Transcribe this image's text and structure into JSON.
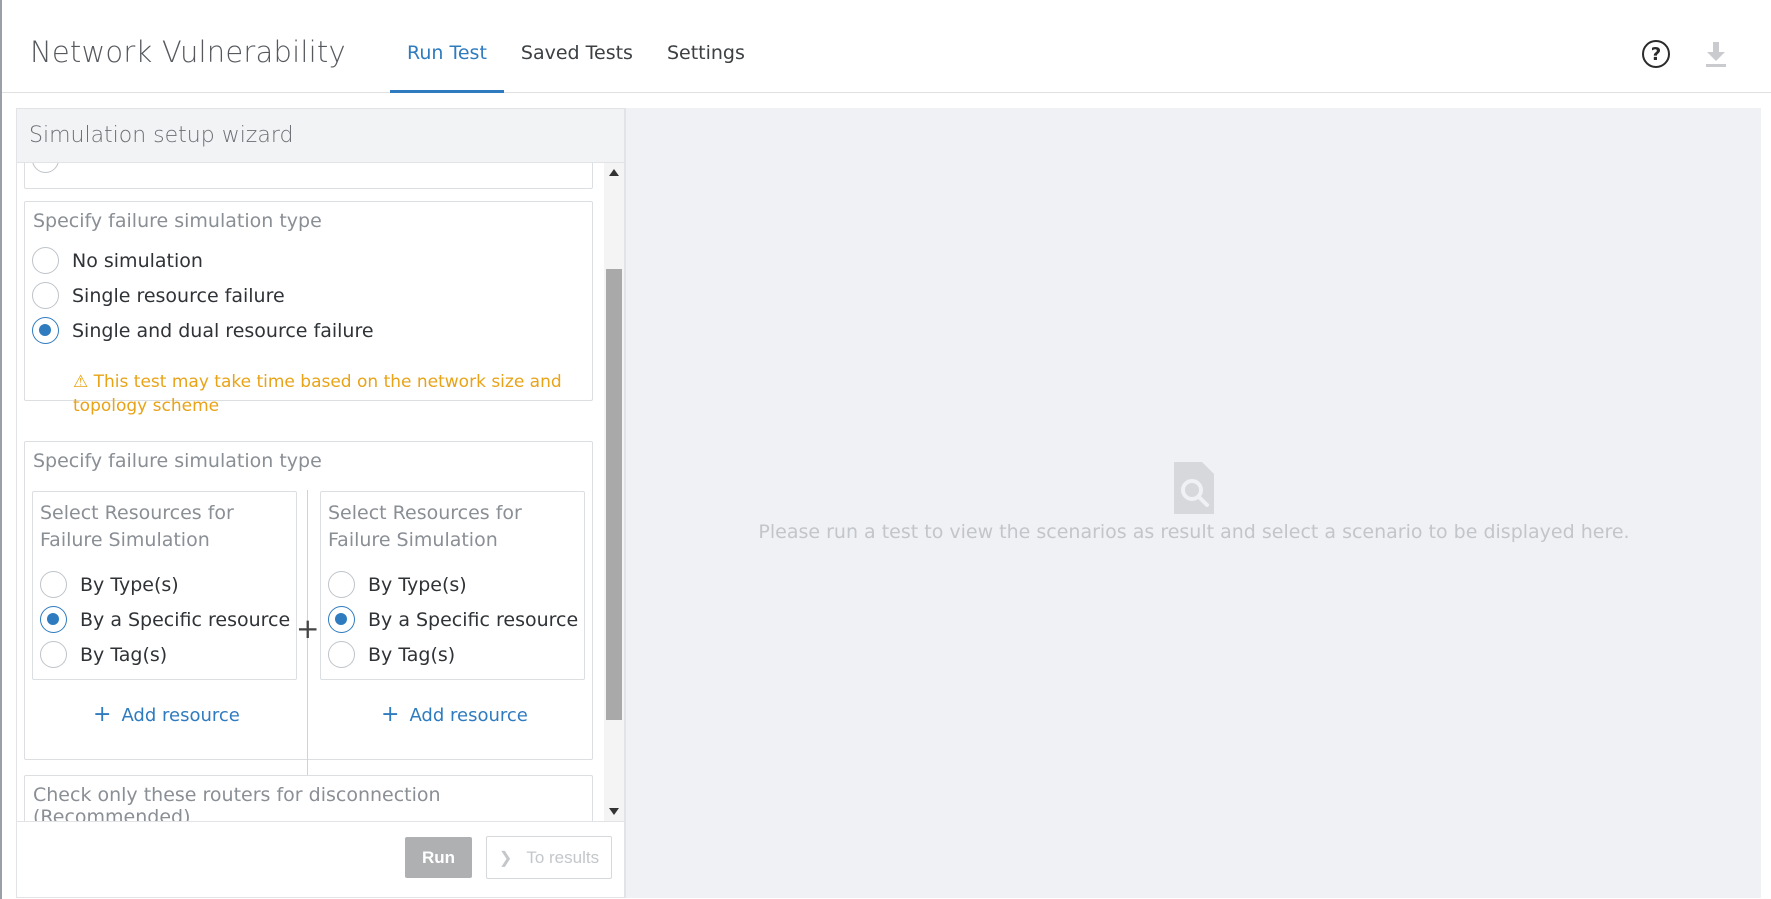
{
  "app": {
    "title": "Network Vulnerability"
  },
  "tabs": [
    {
      "label": "Run Test",
      "active": true
    },
    {
      "label": "Saved Tests",
      "active": false
    },
    {
      "label": "Settings",
      "active": false
    }
  ],
  "header": {
    "help_icon": "help-circle-icon",
    "download_icon": "download-icon"
  },
  "wizard": {
    "title": "Simulation setup wizard",
    "failure_type": {
      "title": "Specify failure simulation type",
      "options": [
        {
          "label": "No simulation",
          "checked": false
        },
        {
          "label": "Single resource failure",
          "checked": false
        },
        {
          "label": "Single and dual resource failure",
          "checked": true
        }
      ],
      "warning": "⚠ This test may take time based on the network size and topology scheme"
    },
    "resources": {
      "title": "Specify failure simulation type",
      "left": {
        "title": "Select Resources for Failure Simulation",
        "options": [
          {
            "label": "By Type(s)",
            "checked": false
          },
          {
            "label": "By a Specific resource",
            "checked": true
          },
          {
            "label": "By Tag(s)",
            "checked": false
          }
        ],
        "add_label": "Add resource"
      },
      "right": {
        "title": "Select Resources for Failure Simulation",
        "options": [
          {
            "label": "By Type(s)",
            "checked": false
          },
          {
            "label": "By a Specific resource",
            "checked": true
          },
          {
            "label": "By Tag(s)",
            "checked": false
          }
        ],
        "add_label": "Add resource"
      },
      "joiner": "+"
    },
    "routers": {
      "title": "Check only these routers for disconnection (Recommended)"
    },
    "footer": {
      "run_label": "Run",
      "results_label": "To results"
    }
  },
  "result": {
    "empty_icon": "file-search-icon",
    "empty_text": "Please run a test to view the scenarios as result and select a scenario to be displayed here."
  },
  "colors": {
    "accent": "#2f7bbf",
    "warning": "#e8a317",
    "status_pill": "#7dc04f"
  }
}
